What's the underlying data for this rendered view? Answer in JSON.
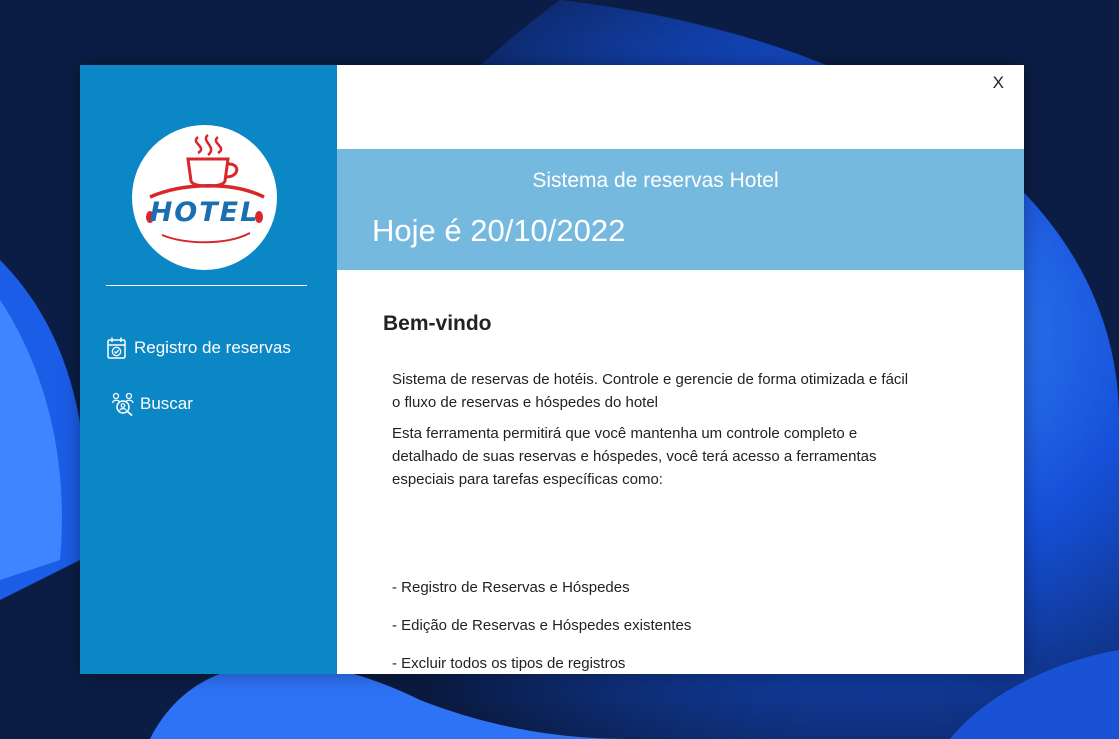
{
  "window": {
    "close_label": "X"
  },
  "sidebar": {
    "logo_text": "HOTEL",
    "items": [
      {
        "label": "Registro de reservas",
        "icon": "calendar-check-icon"
      },
      {
        "label": "Buscar",
        "icon": "user-search-icon"
      }
    ]
  },
  "header": {
    "title": "Sistema de reservas Hotel",
    "date_label": "Hoje é 20/10/2022"
  },
  "main": {
    "welcome": "Bem-vindo",
    "intro_line1": "Sistema de reservas de hotéis. Controle e gerencie de forma otimizada e fácil",
    "intro_line2": "o fluxo de reservas e hóspedes do hotel",
    "desc_line1": "Esta ferramenta permitirá que você mantenha um controle completo e",
    "desc_line2": "detalhado de suas reservas e hóspedes, você terá acesso a ferramentas",
    "desc_line3": "especiais para tarefas específicas como:",
    "features": [
      "- Registro de Reservas e Hóspedes",
      "- Edição de Reservas e Hóspedes existentes",
      "- Excluir todos os tipos de registros"
    ]
  },
  "colors": {
    "sidebar": "#0b87c5",
    "banner": "#76b9df",
    "logo_red": "#d8262b",
    "logo_blue": "#1a6fb0"
  }
}
